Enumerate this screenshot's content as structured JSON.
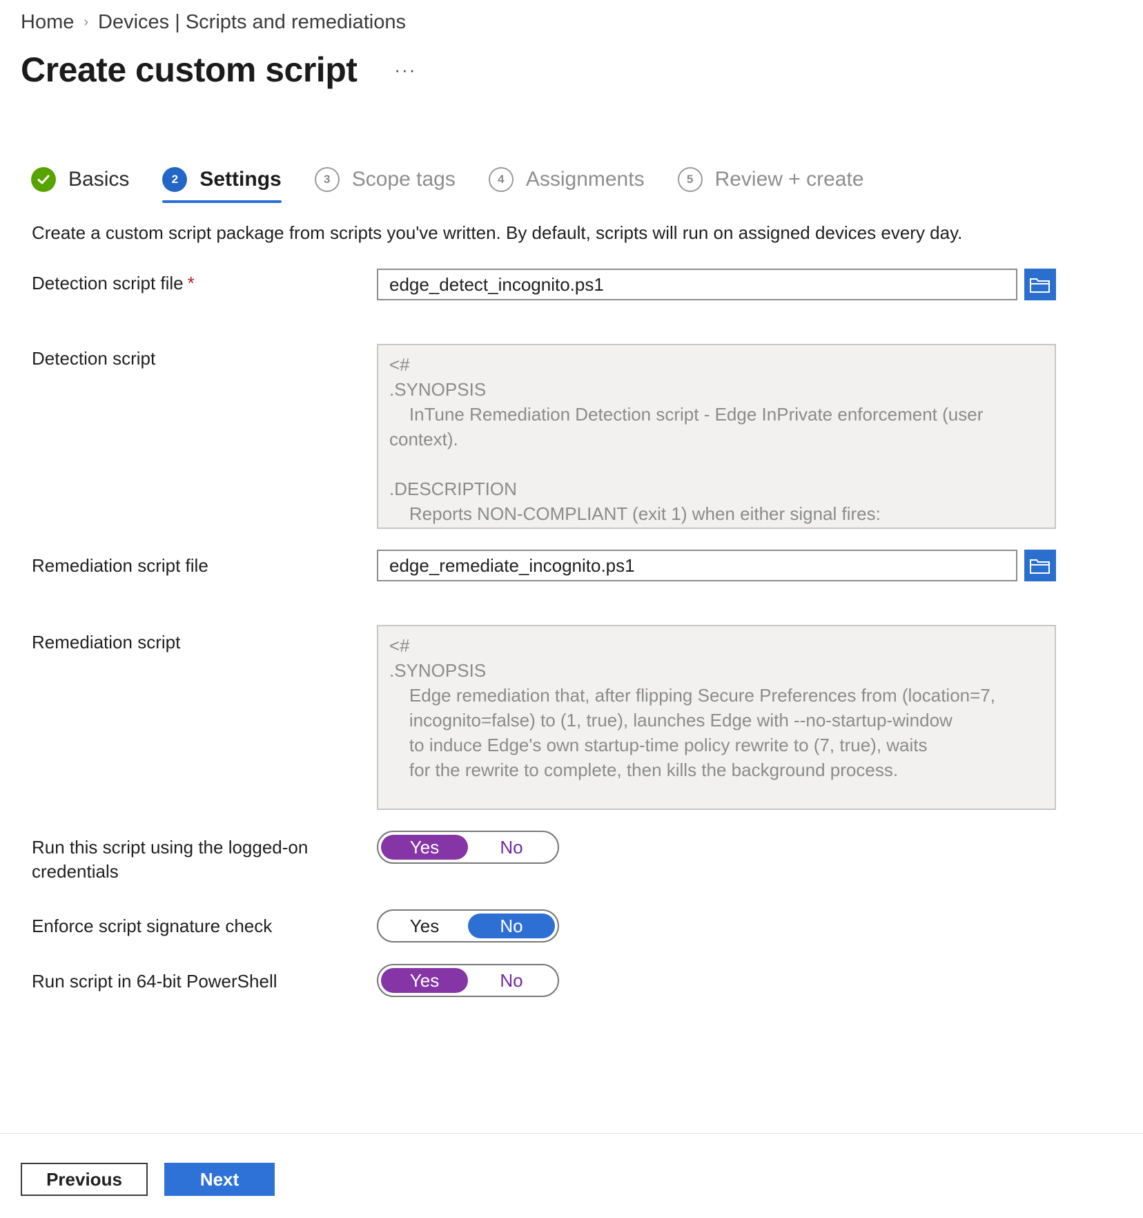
{
  "breadcrumb": {
    "home": "Home",
    "separator": "›",
    "section": "Devices | Scripts and remediations"
  },
  "page": {
    "title": "Create custom script",
    "more": "···"
  },
  "wizard": {
    "steps": [
      {
        "number": "1",
        "label": "Basics",
        "state": "done"
      },
      {
        "number": "2",
        "label": "Settings",
        "state": "active"
      },
      {
        "number": "3",
        "label": "Scope tags",
        "state": "pending"
      },
      {
        "number": "4",
        "label": "Assignments",
        "state": "pending"
      },
      {
        "number": "5",
        "label": "Review + create",
        "state": "pending"
      }
    ]
  },
  "description": "Create a custom script package from scripts you've written. By default, scripts will run on assigned devices every day.",
  "detection_file": {
    "label": "Detection script file",
    "required_marker": "*",
    "value": "edge_detect_incognito.ps1"
  },
  "detection_script": {
    "label": "Detection script",
    "content": "<#\n.SYNOPSIS\n    InTune Remediation Detection script - Edge InPrivate enforcement (user context).\n\n.DESCRIPTION\n    Reports NON-COMPLIANT (exit 1) when either signal fires:"
  },
  "remediation_file": {
    "label": "Remediation script file",
    "value": "edge_remediate_incognito.ps1"
  },
  "remediation_script": {
    "label": "Remediation script",
    "content": "<#\n.SYNOPSIS\n    Edge remediation that, after flipping Secure Preferences from (location=7,\n    incognito=false) to (1, true), launches Edge with --no-startup-window\n    to induce Edge's own startup-time policy rewrite to (7, true), waits\n    for the rewrite to complete, then kills the background process."
  },
  "options": {
    "logged_on": {
      "label": "Run this script using the logged-on credentials",
      "yes": "Yes",
      "no": "No",
      "selected": "Yes"
    },
    "signature": {
      "label": "Enforce script signature check",
      "yes": "Yes",
      "no": "No",
      "selected": "No"
    },
    "powershell64": {
      "label": "Run script in 64-bit PowerShell",
      "yes": "Yes",
      "no": "No",
      "selected": "Yes"
    }
  },
  "footer": {
    "previous": "Previous",
    "next": "Next"
  },
  "colors": {
    "accent_blue": "#2e72d8",
    "toggle_purple": "#8535a6",
    "success_green": "#57a300",
    "required_red": "#a4262c"
  },
  "icons": {
    "separator": "chevron-right-icon",
    "done_step": "checkmark-circle-icon",
    "browse": "folder-open-icon",
    "more": "ellipsis-icon"
  }
}
